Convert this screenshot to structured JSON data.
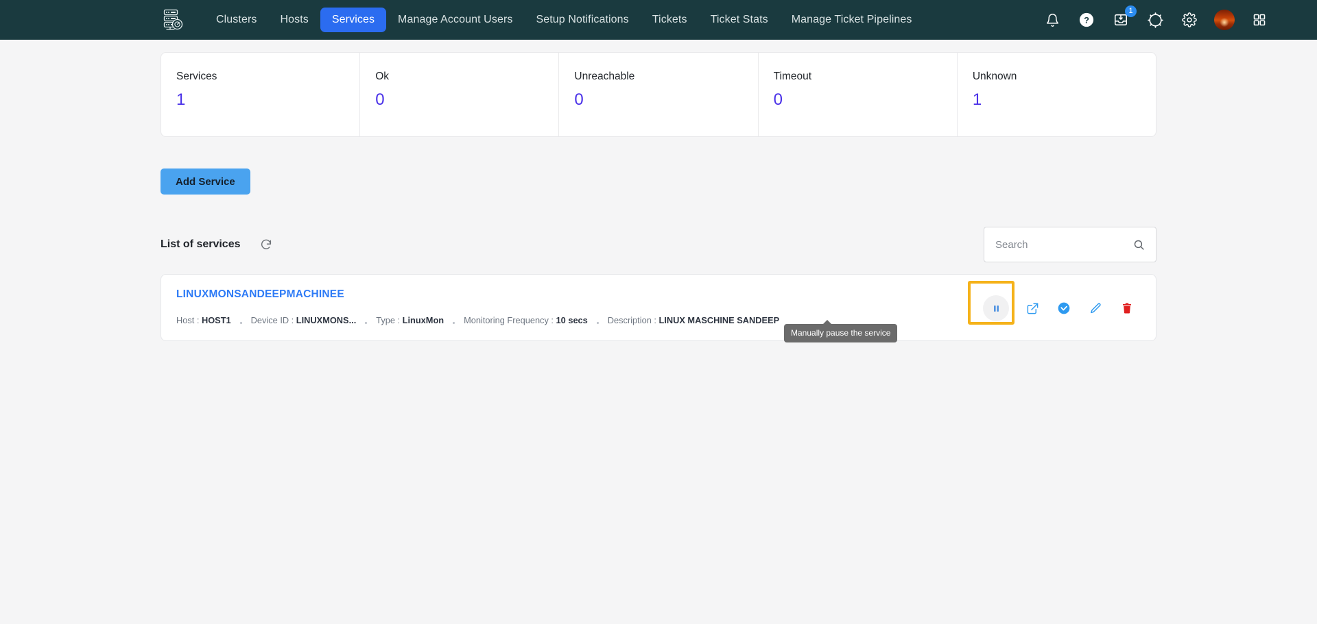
{
  "navbar": {
    "logo_icon": "server-rack-monitor-logo",
    "links": [
      {
        "label": "Clusters",
        "active": false
      },
      {
        "label": "Hosts",
        "active": false
      },
      {
        "label": "Services",
        "active": true
      },
      {
        "label": "Manage Account Users",
        "active": false
      },
      {
        "label": "Setup Notifications",
        "active": false
      },
      {
        "label": "Tickets",
        "active": false
      },
      {
        "label": "Ticket Stats",
        "active": false
      },
      {
        "label": "Manage Ticket Pipelines",
        "active": false
      }
    ],
    "icons": [
      {
        "name": "notifications-bell-icon"
      },
      {
        "name": "help-question-icon"
      },
      {
        "name": "inbox-download-icon",
        "badge": "1"
      },
      {
        "name": "dark-mode-toggle-icon"
      },
      {
        "name": "settings-gear-icon"
      },
      {
        "name": "user-avatar"
      },
      {
        "name": "apps-grid-icon"
      }
    ],
    "active_tab_color": "#2b6cf0",
    "background_color": "#1a3a3f"
  },
  "stats": [
    {
      "label": "Services",
      "value": "1"
    },
    {
      "label": "Ok",
      "value": "0"
    },
    {
      "label": "Unreachable",
      "value": "0"
    },
    {
      "label": "Timeout",
      "value": "0"
    },
    {
      "label": "Unknown",
      "value": "1"
    }
  ],
  "stat_value_color": "#4a31e8",
  "toolbar": {
    "add_service_label": "Add Service",
    "add_service_color": "#4aa3ef"
  },
  "list": {
    "title": "List of services",
    "refresh_icon": "refresh-icon"
  },
  "search": {
    "value": "",
    "placeholder": "Search",
    "icon": "search-icon"
  },
  "service": {
    "name": "LINUXMONSANDEEPMACHINEE",
    "meta": [
      {
        "label": "Host : ",
        "value": "HOST1"
      },
      {
        "label": "Device ID : ",
        "value": "LINUXMONS..."
      },
      {
        "label": "Type : ",
        "value": "LinuxMon"
      },
      {
        "label": "Monitoring Frequency : ",
        "value": "10 secs"
      },
      {
        "label": "Description : ",
        "value": "LINUX MASCHINE SANDEEP"
      }
    ],
    "actions": [
      {
        "name": "pause-service-button",
        "highlighted": true
      },
      {
        "name": "open-external-link-icon"
      },
      {
        "name": "acknowledge-check-icon"
      },
      {
        "name": "edit-pencil-icon"
      },
      {
        "name": "delete-trash-icon"
      }
    ]
  },
  "tooltip": {
    "text": "Manually pause the service",
    "background_color": "#6b6b6b"
  },
  "highlight": {
    "color": "#f5b21a"
  }
}
